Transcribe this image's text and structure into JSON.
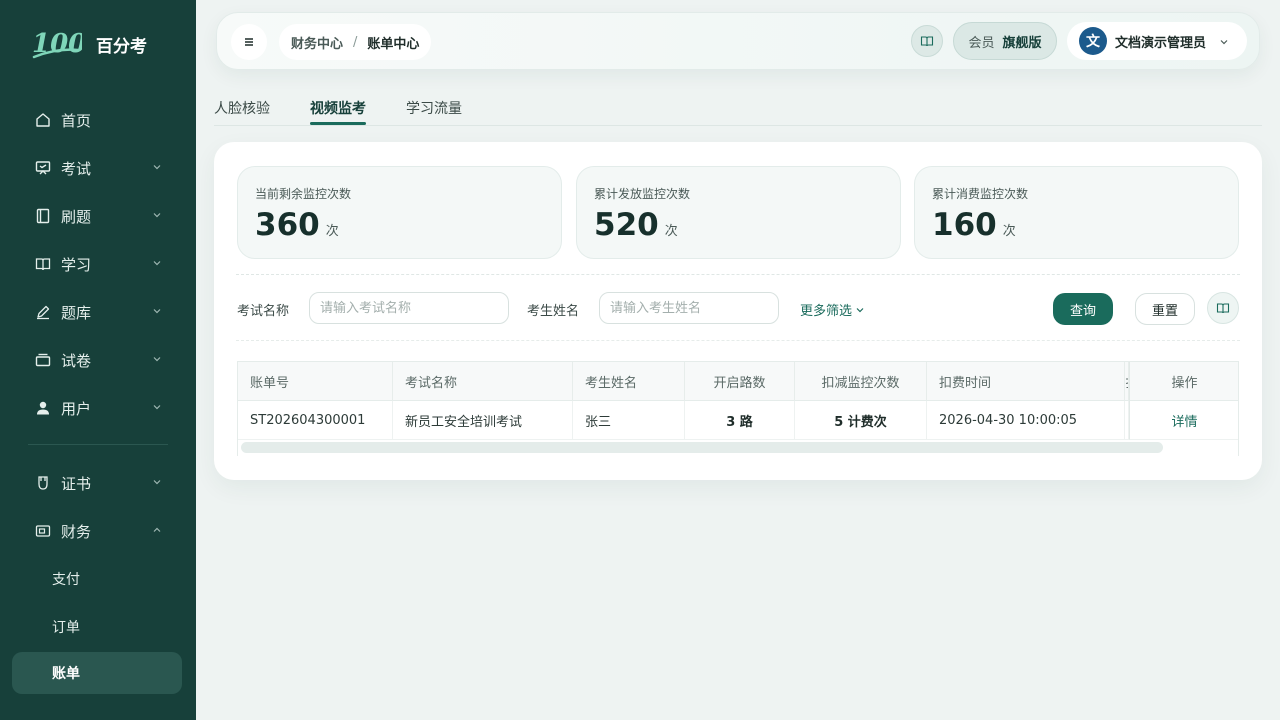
{
  "brand": {
    "logo_text": "百分考",
    "logo_mark": "100"
  },
  "sidebar": {
    "items": [
      {
        "label": "首页",
        "icon": "home-icon"
      },
      {
        "label": "考试",
        "icon": "exam-board-icon"
      },
      {
        "label": "刷题",
        "icon": "notebook-icon"
      },
      {
        "label": "学习",
        "icon": "book-open-icon"
      },
      {
        "label": "题库",
        "icon": "pen-icon"
      },
      {
        "label": "试卷",
        "icon": "tray-icon"
      },
      {
        "label": "用户",
        "icon": "user-icon"
      },
      {
        "label": "证书",
        "icon": "certificate-icon"
      },
      {
        "label": "财务",
        "icon": "finance-icon"
      }
    ],
    "finance_sub": [
      {
        "label": "支付"
      },
      {
        "label": "订单"
      },
      {
        "label": "账单"
      }
    ]
  },
  "header": {
    "crumb1": "财务中心",
    "crumb_sep": "/",
    "crumb2": "账单中心",
    "member_label": "会员",
    "member_level": "旗舰版",
    "avatar_initial": "文",
    "user_name": "文档演示管理员"
  },
  "tabs": [
    {
      "label": "人脸核验"
    },
    {
      "label": "视频监考"
    },
    {
      "label": "学习流量"
    }
  ],
  "stats": [
    {
      "label": "当前剩余监控次数",
      "value": "360",
      "unit": "次"
    },
    {
      "label": "累计发放监控次数",
      "value": "520",
      "unit": "次"
    },
    {
      "label": "累计消费监控次数",
      "value": "160",
      "unit": "次"
    }
  ],
  "filters": {
    "exam_name_label": "考试名称",
    "exam_name_placeholder": "请输入考试名称",
    "student_name_label": "考生姓名",
    "student_name_placeholder": "请输入考生姓名",
    "more_label": "更多筛选",
    "query_label": "查询",
    "reset_label": "重置"
  },
  "table": {
    "columns": [
      "账单号",
      "考试名称",
      "考生姓名",
      "开启路数",
      "扣减监控次数",
      "扣费时间",
      "扌",
      "操作"
    ],
    "rows": [
      {
        "bill_no": "ST202604300001",
        "exam_name": "新员工安全培训考试",
        "student": "张三",
        "channels": "3 路",
        "deducted": "5 计费次",
        "time": "2026-04-30 10:00:05",
        "action": "详情"
      }
    ]
  },
  "colors": {
    "sidebar_bg": "#17403a",
    "accent": "#1a6b5c",
    "page_bg": "#eef3f2"
  }
}
